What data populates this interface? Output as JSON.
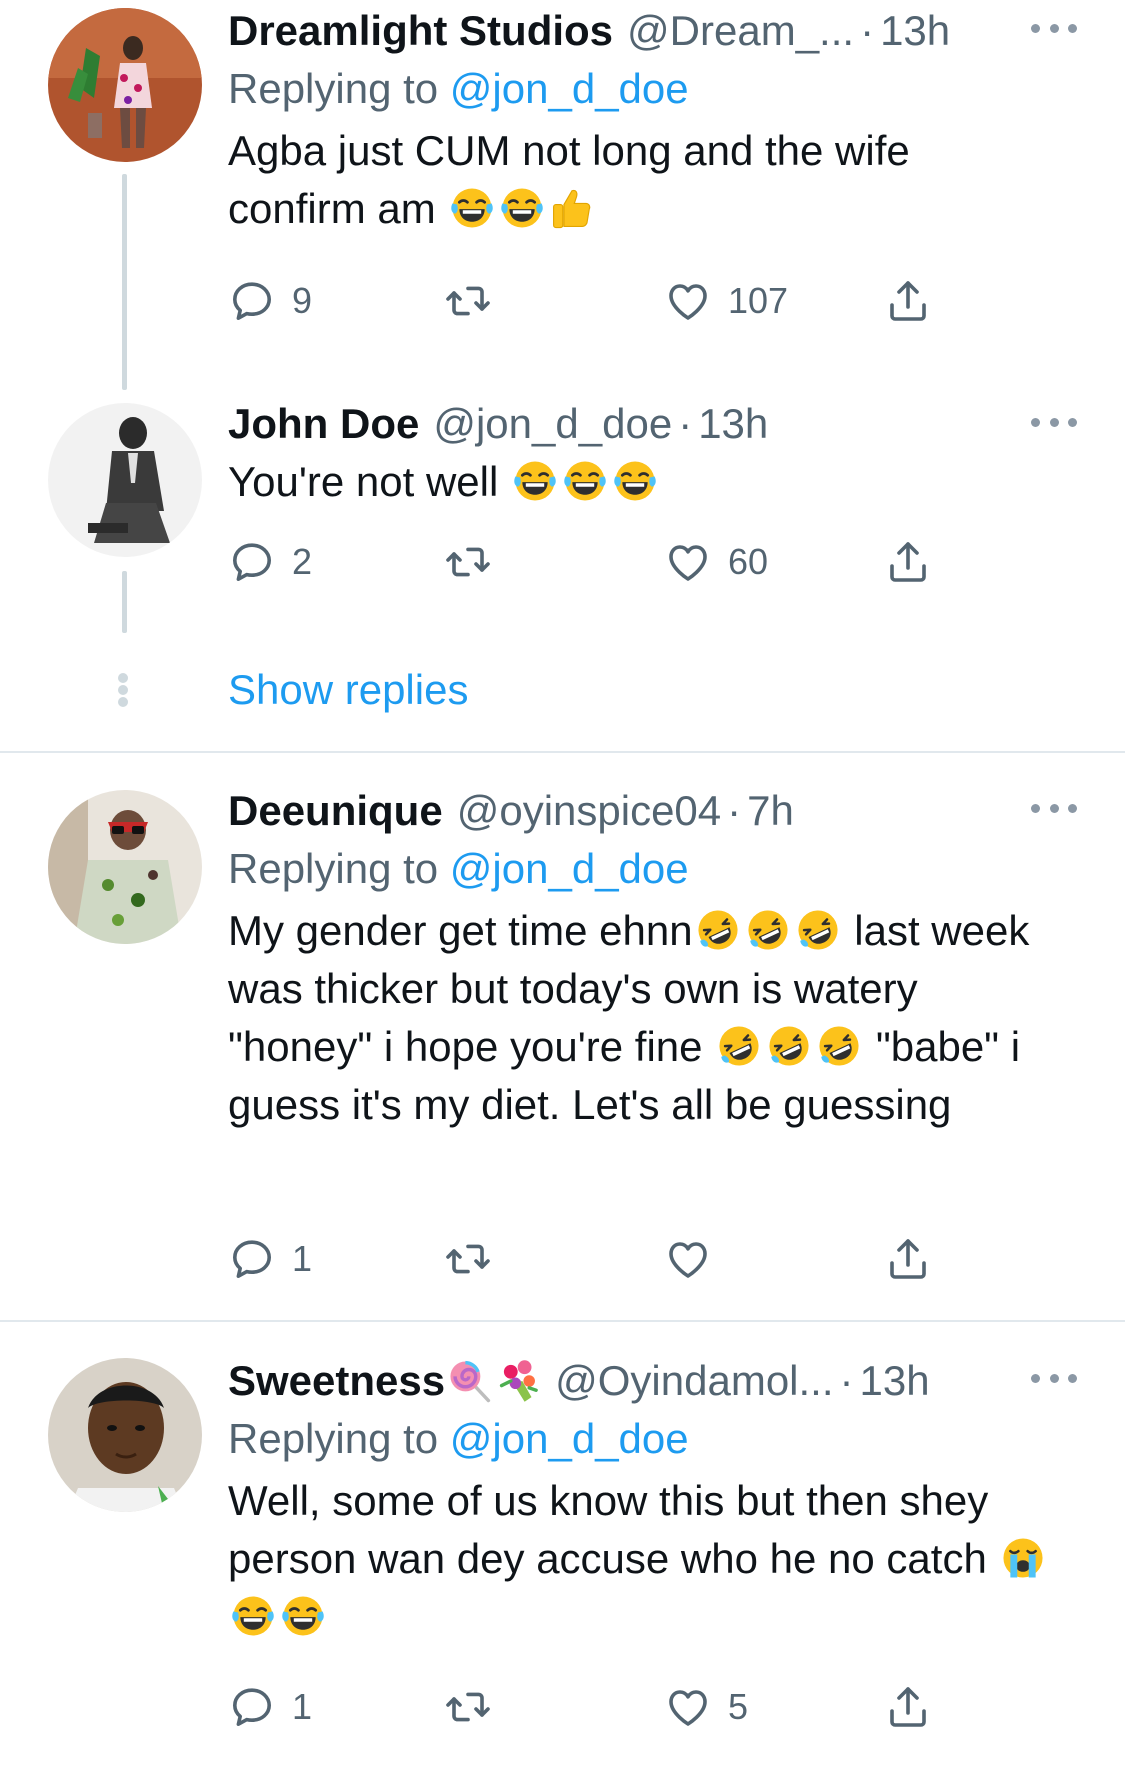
{
  "tweets": [
    {
      "name": "Dreamlight Studios",
      "handle": "@Dream_...",
      "sep": "·",
      "time": "13h",
      "replying_prefix": "Replying to",
      "replying_handle": "@jon_d_doe",
      "text": "Agba just CUM not long and the wife confirm am",
      "emojis": [
        "tears-of-joy",
        "tears-of-joy",
        "thumbs-up"
      ],
      "replies": "9",
      "retweets": "",
      "likes": "107"
    },
    {
      "name": "John Doe",
      "handle": "@jon_d_doe",
      "sep": "·",
      "time": "13h",
      "text": "You're not well",
      "emojis": [
        "tears-of-joy",
        "tears-of-joy",
        "tears-of-joy"
      ],
      "replies": "2",
      "retweets": "",
      "likes": "60"
    },
    {
      "name": "Deeunique",
      "handle": "@oyinspice04",
      "sep": "·",
      "time": "7h",
      "replying_prefix": "Replying to",
      "replying_handle": "@jon_d_doe",
      "text_part1": "My gender get time ehnn",
      "text_part2": " last week was thicker but today's own is watery \"honey\" i hope you're fine ",
      "text_part3": " \"babe\" i guess it's my diet. Let's all be guessing",
      "emojis": [
        "rolling-laughing",
        "rolling-laughing",
        "rolling-laughing",
        "rolling-laughing",
        "rolling-laughing",
        "rolling-laughing"
      ],
      "replies": "1",
      "retweets": "",
      "likes": ""
    },
    {
      "name": "Sweetness",
      "name_emojis": [
        "lollipop",
        "bouquet"
      ],
      "handle": "@Oyindamol...",
      "sep": "·",
      "time": "13h",
      "replying_prefix": "Replying to",
      "replying_handle": "@jon_d_doe",
      "text": "Well, some of us know this but then shey person wan dey accuse who he no catch",
      "emojis": [
        "loudly-crying",
        "tears-of-joy",
        "tears-of-joy"
      ],
      "replies": "1",
      "retweets": "",
      "likes": "5"
    }
  ],
  "show_replies": "Show replies",
  "colors": {
    "link": "#1d9bf0",
    "secondary": "#536471",
    "icon": "#536471",
    "thread_line": "#cfd9de",
    "divider": "#e1e8ed"
  }
}
